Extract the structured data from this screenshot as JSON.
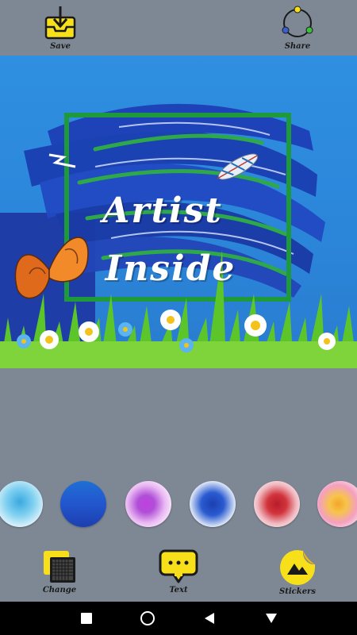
{
  "toolbar": {
    "save_label": "Save",
    "share_label": "Share"
  },
  "canvas": {
    "line1": "Artist",
    "line2": "Inside"
  },
  "backgrounds": [
    {
      "name": "watercolor-cyan"
    },
    {
      "name": "blue-gradient"
    },
    {
      "name": "purple-splash"
    },
    {
      "name": "blue-brush-frame"
    },
    {
      "name": "red-splash"
    },
    {
      "name": "orange-pink-splash"
    }
  ],
  "bottom_tools": {
    "change_label": "Change",
    "text_label": "Text",
    "stickers_label": "Stickers"
  },
  "colors": {
    "accent_yellow": "#f7e01a",
    "background_gray": "#7e8894",
    "canvas_blue": "#2f8fe0"
  }
}
